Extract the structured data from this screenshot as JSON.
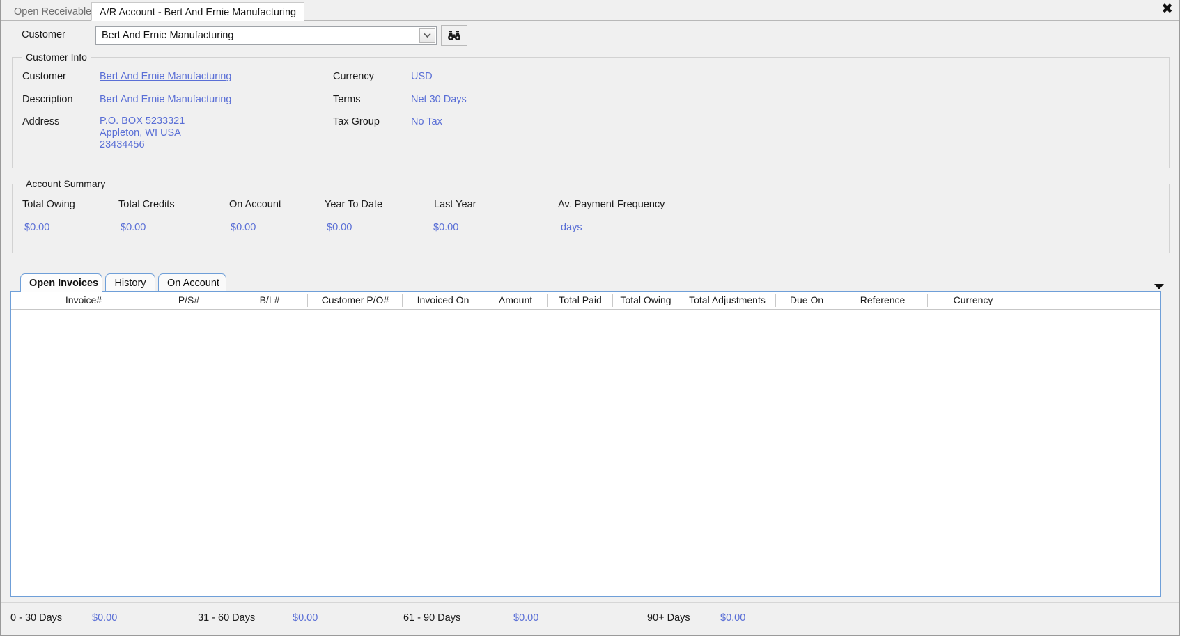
{
  "window": {
    "tabs": [
      {
        "label": "Open Receivables",
        "active": false
      },
      {
        "label": "A/R Account - Bert And Ernie Manufacturing",
        "active": true
      }
    ],
    "close_label": "✖"
  },
  "selector": {
    "label": "Customer",
    "value": "Bert And Ernie Manufacturing",
    "placeholder": "Bert And Ernie Manufacturing",
    "dropdown_icon": "chevron-down-icon",
    "find_icon": "binoculars-icon"
  },
  "customer_info": {
    "title": "Customer Info",
    "left": [
      {
        "label": "Customer",
        "value": "Bert And Ernie Manufacturing",
        "link": true
      },
      {
        "label": "Description",
        "value": "Bert And Ernie Manufacturing",
        "link": false
      },
      {
        "label": "Address",
        "value": "P.O. BOX 5233321\nAppleton, WI USA\n23434456",
        "link": false
      }
    ],
    "right": [
      {
        "label": "Currency",
        "value": "USD"
      },
      {
        "label": "Terms",
        "value": "Net 30 Days"
      },
      {
        "label": "Tax Group",
        "value": "No Tax"
      }
    ]
  },
  "account_summary": {
    "title": "Account Summary",
    "items": [
      {
        "label": "Total Owing",
        "value": "$0.00"
      },
      {
        "label": "Total Credits",
        "value": "$0.00"
      },
      {
        "label": "On Account",
        "value": "$0.00"
      },
      {
        "label": "Year To Date",
        "value": "$0.00"
      },
      {
        "label": "Last Year",
        "value": "$0.00"
      },
      {
        "label": "Av. Payment Frequency",
        "value": "days"
      }
    ]
  },
  "detail_tabs": [
    {
      "label": "Open Invoices",
      "active": true
    },
    {
      "label": "History",
      "active": false
    },
    {
      "label": "On Account",
      "active": false
    }
  ],
  "grid": {
    "columns": [
      "Invoice#",
      "P/S#",
      "B/L#",
      "Customer P/O#",
      "Invoiced On",
      "Amount",
      "Total Paid",
      "Total Owing",
      "Total Adjustments",
      "Due On",
      "Reference",
      "Currency"
    ],
    "rows": []
  },
  "aging": [
    {
      "label": "0 - 30 Days",
      "value": "$0.00"
    },
    {
      "label": "31 - 60 Days",
      "value": "$0.00"
    },
    {
      "label": "61 - 90 Days",
      "value": "$0.00"
    },
    {
      "label": "90+ Days",
      "value": "$0.00"
    }
  ],
  "colors": {
    "value_blue": "#5a6fd6",
    "tab_border": "#6f9fd8",
    "panel_bg": "#f0f0f0"
  }
}
